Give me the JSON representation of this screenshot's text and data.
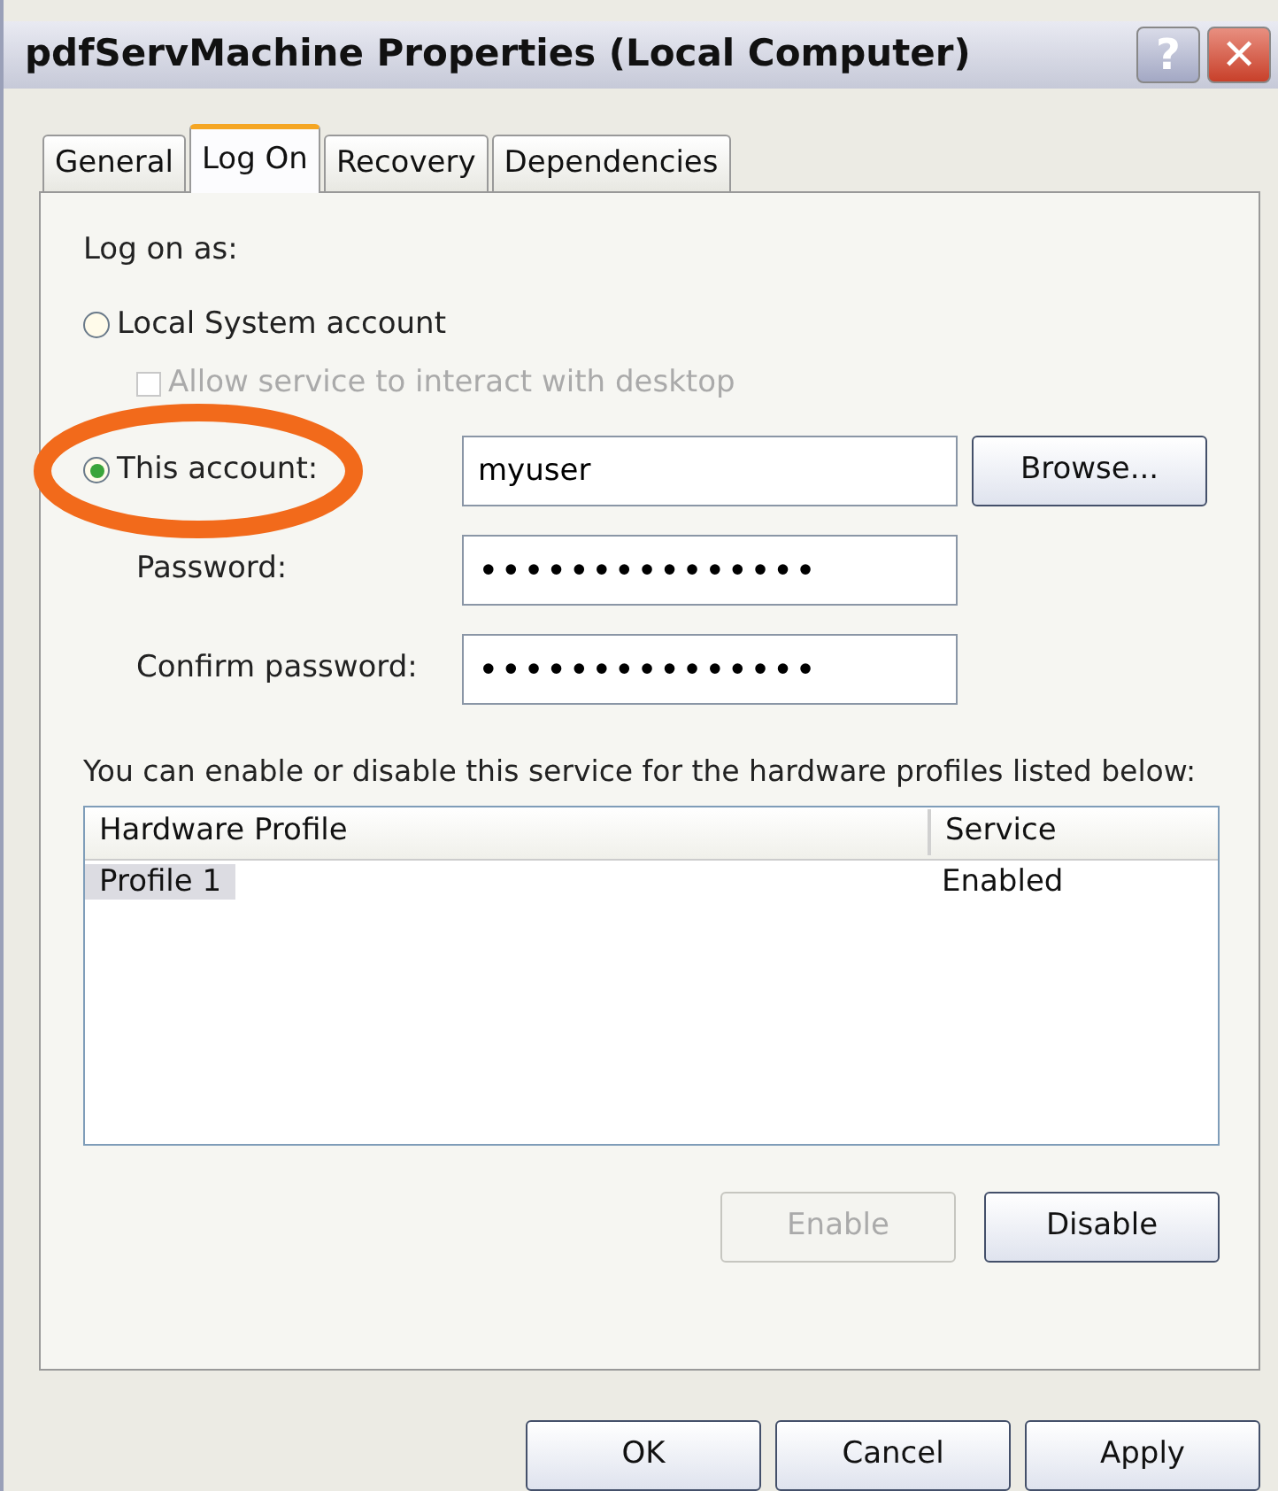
{
  "window": {
    "title": "pdfServMachine Properties (Local Computer)",
    "help": "?",
    "close": "✕"
  },
  "tabs": [
    {
      "label": "General",
      "selected": false
    },
    {
      "label": "Log On",
      "selected": true
    },
    {
      "label": "Recovery",
      "selected": false
    },
    {
      "label": "Dependencies",
      "selected": false
    }
  ],
  "log_on_as": "Log on as:",
  "local_system": {
    "label": "Local System account",
    "selected": false
  },
  "interact": {
    "label": "Allow service to interact with desktop",
    "checked": false,
    "disabled": true
  },
  "this_account": {
    "label": "This account:",
    "selected": true,
    "value": "myuser",
    "browse": "Browse..."
  },
  "password": {
    "label": "Password:",
    "value": "•••••••••••••••"
  },
  "confirm": {
    "label": "Confirm password:",
    "value": "•••••••••••••••"
  },
  "profiles_label": "You can enable or disable this service for the hardware profiles listed below:",
  "table": {
    "columns": [
      "Hardware Profile",
      "Service"
    ],
    "rows": [
      {
        "cells": [
          "Profile 1",
          "Enabled"
        ],
        "selected": true
      }
    ]
  },
  "profile_buttons": [
    {
      "label": "Enable",
      "disabled": true
    },
    {
      "label": "Disable",
      "disabled": false
    }
  ],
  "buttons": [
    "OK",
    "Cancel",
    "Apply"
  ]
}
